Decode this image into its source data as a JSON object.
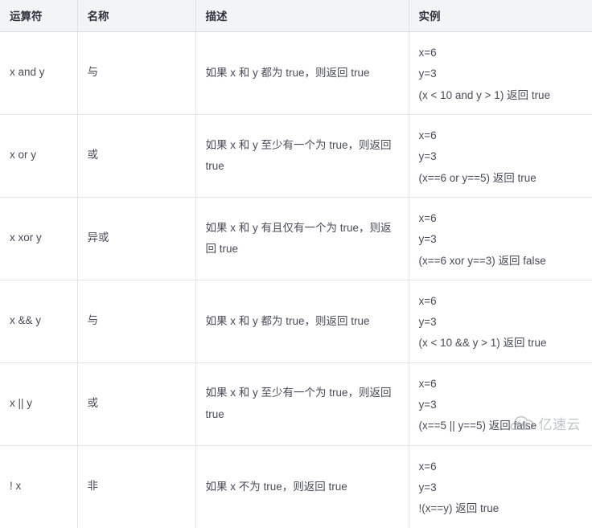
{
  "table": {
    "headers": [
      "运算符",
      "名称",
      "描述",
      "实例"
    ],
    "rows": [
      {
        "operator": "x and y",
        "name": "与",
        "description": "如果 x 和 y 都为 true，则返回 true",
        "example": [
          "x=6",
          "y=3",
          "(x < 10 and y > 1) 返回 true"
        ]
      },
      {
        "operator": "x or y",
        "name": "或",
        "description": "如果 x 和 y 至少有一个为 true，则返回 true",
        "example": [
          "x=6",
          "y=3",
          "(x==6 or y==5) 返回 true"
        ]
      },
      {
        "operator": "x xor y",
        "name": "异或",
        "description": "如果 x 和 y 有且仅有一个为 true，则返回 true",
        "example": [
          "x=6",
          "y=3",
          "(x==6 xor y==3) 返回 false"
        ]
      },
      {
        "operator": "x && y",
        "name": "与",
        "description": "如果 x 和 y 都为 true，则返回 true",
        "example": [
          "x=6",
          "y=3",
          "(x < 10 && y > 1) 返回 true"
        ]
      },
      {
        "operator": "x || y",
        "name": "或",
        "description": "如果 x 和 y 至少有一个为 true，则返回 true",
        "example": [
          "x=6",
          "y=3",
          "(x==5 || y==5) 返回 false"
        ]
      },
      {
        "operator": "! x",
        "name": "非",
        "description": "如果 x 不为 true，则返回 true",
        "example": [
          "x=6",
          "y=3",
          "!(x==y) 返回 true"
        ]
      }
    ]
  },
  "watermark": {
    "text": "亿速云",
    "icon": "cloud-icon",
    "color": "#9aa0a6"
  },
  "colors": {
    "header_background": "#f2f4f6",
    "header_text": "#33333f",
    "body_text": "#4a4a5a",
    "border": "#e6e6e6",
    "header_border": "#d8dbe0"
  }
}
